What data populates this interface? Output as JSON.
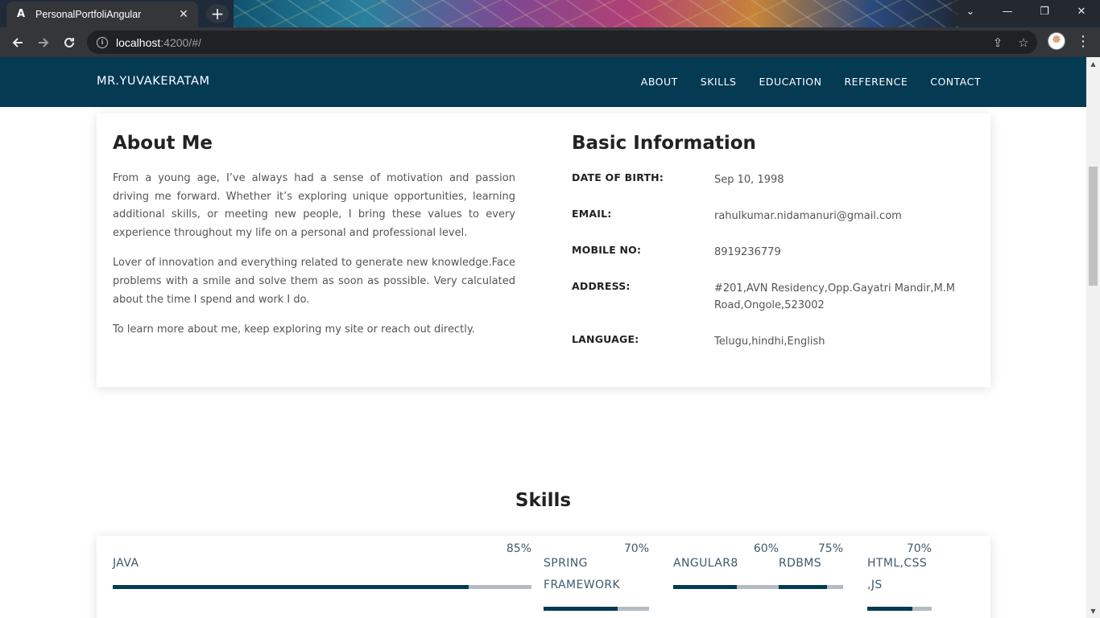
{
  "browser": {
    "tab_title": "PersonalPortfoliAngular",
    "url_host": "localhost",
    "url_rest": ":4200/#/"
  },
  "nav": {
    "brand": "MR.YUVAKERATAM",
    "links": [
      "ABOUT",
      "SKILLS",
      "EDUCATION",
      "REFERENCE",
      "CONTACT"
    ]
  },
  "about": {
    "title": "About Me",
    "paragraphs": [
      "From a young age, I’ve always had a sense of motivation and passion driving me forward. Whether it’s exploring unique opportunities, learning additional skills, or meeting new people, I bring these values to every experience throughout my life on a personal and professional level.",
      "Lover of innovation and everything related to generate new knowledge.Face problems with a smile and solve them as soon as possible. Very calculated about the time I spend and work I do.",
      "To learn more about me, keep exploring my site or reach out directly."
    ]
  },
  "basic_info": {
    "title": "Basic Information",
    "rows": [
      {
        "label": "DATE OF BIRTH:",
        "value": "Sep 10, 1998"
      },
      {
        "label": "EMAIL:",
        "value": "rahulkumar.nidamanuri@gmail.com"
      },
      {
        "label": "MOBILE NO:",
        "value": "8919236779"
      },
      {
        "label": "ADDRESS:",
        "value": "#201,AVN Residency,Opp.Gayatri Mandir,M.M Road,Ongole,523002"
      },
      {
        "label": "LANGUAGE:",
        "value": "Telugu,hindhi,English"
      }
    ]
  },
  "skills": {
    "title": "Skills",
    "items": [
      {
        "name": "JAVA",
        "percent_label": "85%",
        "level": 0.85
      },
      {
        "name": "SPRING FRAMEWORK",
        "percent_label": "70%",
        "level": 0.7
      },
      {
        "name": "ANGULAR8",
        "percent_label": "60%",
        "level": 0.6
      },
      {
        "name": "RDBMS",
        "percent_label": "75%",
        "level": 0.75
      },
      {
        "name": "HTML,CSS ,JS",
        "percent_label": "70%",
        "level": 0.7
      }
    ]
  },
  "colors": {
    "nav_bg": "#043a52",
    "bar_fill": "#043a52",
    "bar_track": "#b3bcc2"
  }
}
